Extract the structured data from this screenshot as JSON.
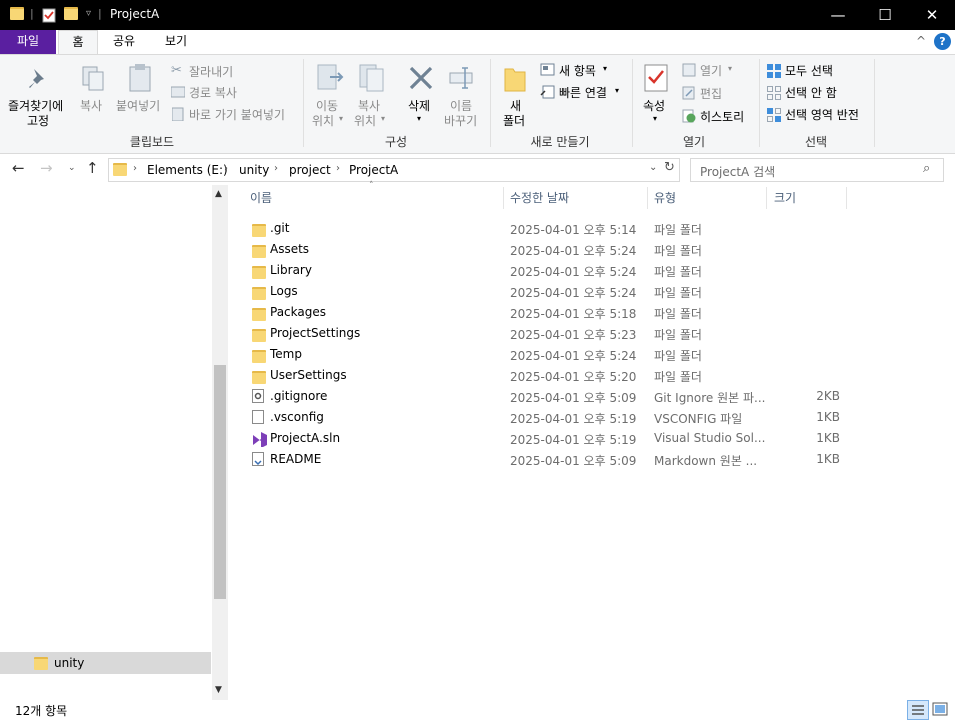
{
  "window": {
    "title": "ProjectA"
  },
  "ribbon_tabs": [
    "파일",
    "홈",
    "공유",
    "보기"
  ],
  "ribbon": {
    "clipboard": {
      "pin_label_1": "즐겨찾기에",
      "pin_label_2": "고정",
      "copy_label": "복사",
      "paste_label": "붙여넣기",
      "cut_label": "잘라내기",
      "copy_path_label": "경로 복사",
      "paste_shortcut_label": "바로 가기 붙여넣기",
      "group_label": "클립보드"
    },
    "organize": {
      "move_label_1": "이동",
      "move_label_2": "위치",
      "copyto_label_1": "복사",
      "copyto_label_2": "위치",
      "delete_label": "삭제",
      "rename_label_1": "이름",
      "rename_label_2": "바꾸기",
      "group_label": "구성"
    },
    "new": {
      "new_folder_label_1": "새",
      "new_folder_label_2": "폴더",
      "new_item_label": "새 항목",
      "easy_access_label": "빠른 연결",
      "group_label": "새로 만들기"
    },
    "open": {
      "properties_label": "속성",
      "open_label": "열기",
      "edit_label": "편집",
      "history_label": "히스토리",
      "group_label": "열기"
    },
    "select": {
      "select_all_label": "모두 선택",
      "select_none_label": "선택 안 함",
      "invert_label": "선택 영역 반전",
      "group_label": "선택"
    }
  },
  "address": {
    "breadcrumb": [
      "Elements (E:)",
      "unity",
      "project",
      "ProjectA"
    ],
    "search_placeholder": "ProjectA 검색"
  },
  "nav_pane": {
    "items": [
      "unity"
    ]
  },
  "columns": [
    "이름",
    "수정한 날짜",
    "유형",
    "크기"
  ],
  "files": [
    {
      "name": ".git",
      "date": "2025-04-01 오후 5:14",
      "type": "파일 폴더",
      "size": "",
      "icon": "folder-icon"
    },
    {
      "name": "Assets",
      "date": "2025-04-01 오후 5:24",
      "type": "파일 폴더",
      "size": "",
      "icon": "folder-icon"
    },
    {
      "name": "Library",
      "date": "2025-04-01 오후 5:24",
      "type": "파일 폴더",
      "size": "",
      "icon": "folder-icon"
    },
    {
      "name": "Logs",
      "date": "2025-04-01 오후 5:24",
      "type": "파일 폴더",
      "size": "",
      "icon": "folder-icon"
    },
    {
      "name": "Packages",
      "date": "2025-04-01 오후 5:18",
      "type": "파일 폴더",
      "size": "",
      "icon": "folder-icon"
    },
    {
      "name": "ProjectSettings",
      "date": "2025-04-01 오후 5:23",
      "type": "파일 폴더",
      "size": "",
      "icon": "folder-icon"
    },
    {
      "name": "Temp",
      "date": "2025-04-01 오후 5:24",
      "type": "파일 폴더",
      "size": "",
      "icon": "folder-icon"
    },
    {
      "name": "UserSettings",
      "date": "2025-04-01 오후 5:20",
      "type": "파일 폴더",
      "size": "",
      "icon": "folder-icon"
    },
    {
      "name": ".gitignore",
      "date": "2025-04-01 오후 5:09",
      "type": "Git Ignore 원본 파...",
      "size": "2KB",
      "icon": "gear-file-icon"
    },
    {
      "name": ".vsconfig",
      "date": "2025-04-01 오후 5:19",
      "type": "VSCONFIG 파일",
      "size": "1KB",
      "icon": "file-icon"
    },
    {
      "name": "ProjectA.sln",
      "date": "2025-04-01 오후 5:19",
      "type": "Visual Studio Sol...",
      "size": "1KB",
      "icon": "visual-studio-icon"
    },
    {
      "name": "README",
      "date": "2025-04-01 오후 5:09",
      "type": "Markdown 원본 ...",
      "size": "1KB",
      "icon": "markdown-file-icon"
    }
  ],
  "status": {
    "item_count": "12개 항목"
  },
  "colors": {
    "file_tab": "#5a1fa0",
    "folder": "#f8d775",
    "accent": "#1e73c8"
  }
}
